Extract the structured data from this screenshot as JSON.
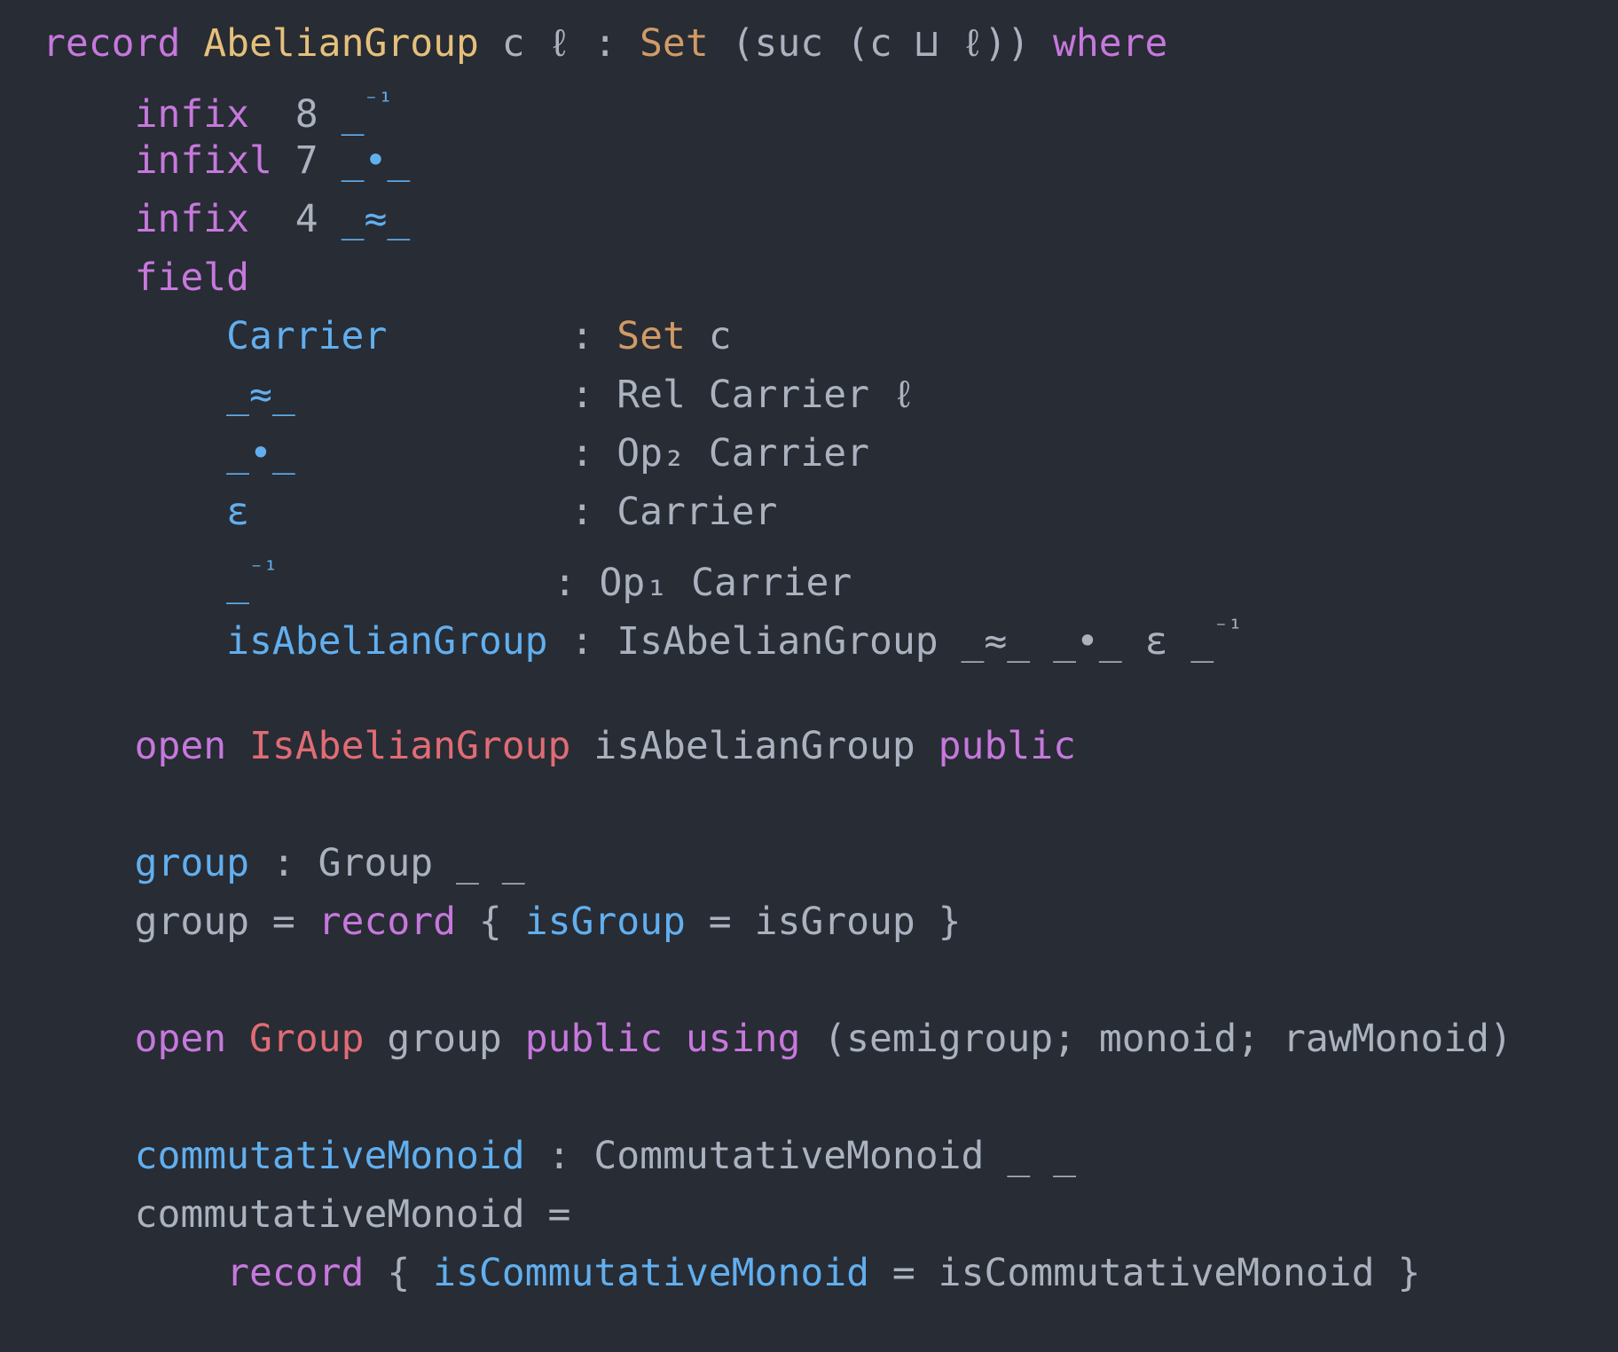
{
  "theme": {
    "background": "#282c34",
    "text": "#abb2bf",
    "keyword": "#c678dd",
    "type": "#e5c07b",
    "sort": "#d19a66",
    "function": "#61afef",
    "module": "#e06c75"
  },
  "language": "Agda",
  "code_lines": [
    {
      "indent": 0,
      "tokens": [
        [
          "kw",
          "record"
        ],
        [
          "tx",
          " "
        ],
        [
          "ty",
          "AbelianGroup"
        ],
        [
          "tx",
          " c ℓ : "
        ],
        [
          "set",
          "Set"
        ],
        [
          "tx",
          " (suc (c ⊔ ℓ)) "
        ],
        [
          "kw",
          "where"
        ]
      ]
    },
    {
      "indent": 4,
      "tokens": [
        [
          "kw",
          "infix"
        ],
        [
          "tx",
          "  8 "
        ],
        [
          "fn",
          "_"
        ],
        [
          "fnsup",
          "⁻¹"
        ]
      ]
    },
    {
      "indent": 4,
      "tokens": [
        [
          "kw",
          "infixl"
        ],
        [
          "tx",
          " 7 "
        ],
        [
          "fn",
          "_•_"
        ]
      ]
    },
    {
      "indent": 4,
      "tokens": [
        [
          "kw",
          "infix"
        ],
        [
          "tx",
          "  4 "
        ],
        [
          "fn",
          "_≈_"
        ]
      ]
    },
    {
      "indent": 4,
      "tokens": [
        [
          "kw",
          "field"
        ]
      ]
    },
    {
      "indent": 8,
      "tokens": [
        [
          "fn",
          "Carrier"
        ],
        [
          "tx",
          "        : "
        ],
        [
          "set",
          "Set"
        ],
        [
          "tx",
          " c"
        ]
      ]
    },
    {
      "indent": 8,
      "tokens": [
        [
          "fn",
          "_≈_"
        ],
        [
          "tx",
          "            : Rel Carrier ℓ"
        ]
      ]
    },
    {
      "indent": 8,
      "tokens": [
        [
          "fn",
          "_•_"
        ],
        [
          "tx",
          "            : Op₂ Carrier"
        ]
      ]
    },
    {
      "indent": 8,
      "tokens": [
        [
          "fn",
          "ε"
        ],
        [
          "tx",
          "              : Carrier"
        ]
      ]
    },
    {
      "indent": 8,
      "tokens": [
        [
          "fn",
          "_"
        ],
        [
          "fnsup",
          "⁻¹"
        ],
        [
          "tx",
          "            : Op₁ Carrier"
        ]
      ]
    },
    {
      "indent": 8,
      "tokens": [
        [
          "fn",
          "isAbelianGroup"
        ],
        [
          "tx",
          " : IsAbelianGroup _≈_ _•_ ε _"
        ],
        [
          "txsup",
          "⁻¹"
        ]
      ]
    },
    {
      "indent": 0,
      "tokens": []
    },
    {
      "indent": 4,
      "tokens": [
        [
          "kw",
          "open"
        ],
        [
          "tx",
          " "
        ],
        [
          "mod",
          "IsAbelianGroup"
        ],
        [
          "tx",
          " isAbelianGroup "
        ],
        [
          "kw",
          "public"
        ]
      ]
    },
    {
      "indent": 0,
      "tokens": []
    },
    {
      "indent": 4,
      "tokens": [
        [
          "fn",
          "group"
        ],
        [
          "tx",
          " : Group _ _"
        ]
      ]
    },
    {
      "indent": 4,
      "tokens": [
        [
          "tx",
          "group = "
        ],
        [
          "kw",
          "record"
        ],
        [
          "tx",
          " { "
        ],
        [
          "fn",
          "isGroup"
        ],
        [
          "tx",
          " = isGroup }"
        ]
      ]
    },
    {
      "indent": 0,
      "tokens": []
    },
    {
      "indent": 4,
      "tokens": [
        [
          "kw",
          "open"
        ],
        [
          "tx",
          " "
        ],
        [
          "mod",
          "Group"
        ],
        [
          "tx",
          " group "
        ],
        [
          "kw",
          "public"
        ],
        [
          "tx",
          " "
        ],
        [
          "kw",
          "using"
        ],
        [
          "tx",
          " (semigroup; monoid; rawMonoid)"
        ]
      ]
    },
    {
      "indent": 0,
      "tokens": []
    },
    {
      "indent": 4,
      "tokens": [
        [
          "fn",
          "commutativeMonoid"
        ],
        [
          "tx",
          " : CommutativeMonoid _ _"
        ]
      ]
    },
    {
      "indent": 4,
      "tokens": [
        [
          "tx",
          "commutativeMonoid ="
        ]
      ]
    },
    {
      "indent": 8,
      "tokens": [
        [
          "kw",
          "record"
        ],
        [
          "tx",
          " { "
        ],
        [
          "fn",
          "isCommutativeMonoid"
        ],
        [
          "tx",
          " = isCommutativeMonoid }"
        ]
      ]
    }
  ]
}
